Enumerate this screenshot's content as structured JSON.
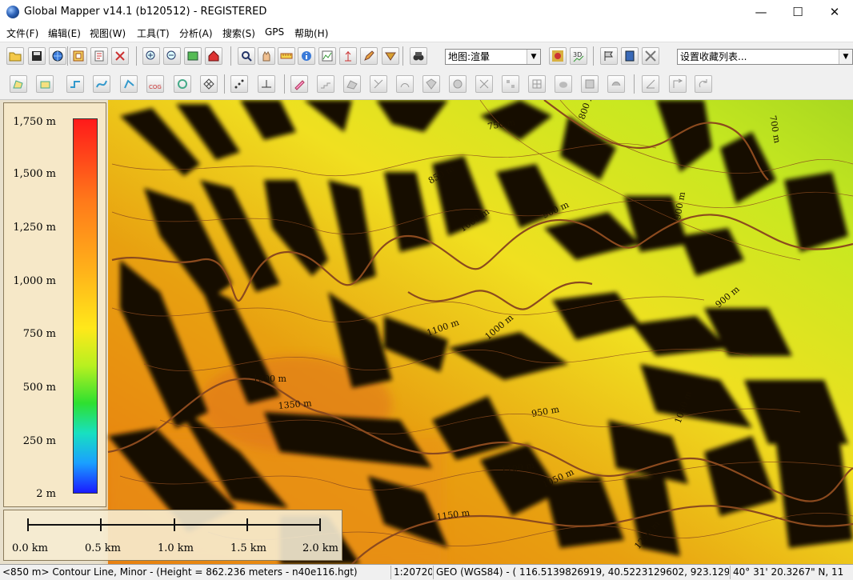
{
  "window": {
    "title": "Global Mapper v14.1 (b120512) - REGISTERED",
    "minimize": "—",
    "maximize": "☐",
    "close": "✕"
  },
  "menu": [
    "文件(F)",
    "编辑(E)",
    "视图(W)",
    "工具(T)",
    "分析(A)",
    "搜索(S)",
    "GPS",
    "帮助(H)"
  ],
  "toolbar": {
    "map_layer_select": "地图:渲暈",
    "favorites_select": "设置收藏列表..."
  },
  "legend": {
    "labels": [
      "1,750 m",
      "1,500 m",
      "1,250 m",
      "1,000 m",
      "750 m",
      "500 m",
      "250 m",
      "2 m"
    ]
  },
  "scale": {
    "labels": [
      "0.0 km",
      "0.5 km",
      "1.0 km",
      "1.5 km",
      "2.0 km"
    ]
  },
  "contours": {
    "labels": [
      "750 m",
      "800 m",
      "700 m",
      "850 m",
      "1000 m",
      "900 m",
      "900 m",
      "900 m",
      "1100 m",
      "1000 m",
      "1300 m",
      "1350 m",
      "950 m",
      "1050 m",
      "1100 m",
      "1050 m",
      "1150 m",
      "1250 m"
    ]
  },
  "status": {
    "feature": "<850 m> Contour Line, Minor - (Height = 862.236 meters - n40e116.hgt)",
    "scale": "1:20720",
    "coords": "GEO (WGS84) - ( 116.5139826919, 40.5223129602, 923.129 m )",
    "dms": "40° 31' 20.3267\" N, 11"
  },
  "colors": {
    "contour": "#8b4a1e",
    "terrain_high": "#e87a10",
    "terrain_mid": "#f0e020",
    "terrain_low": "#a8d820"
  }
}
